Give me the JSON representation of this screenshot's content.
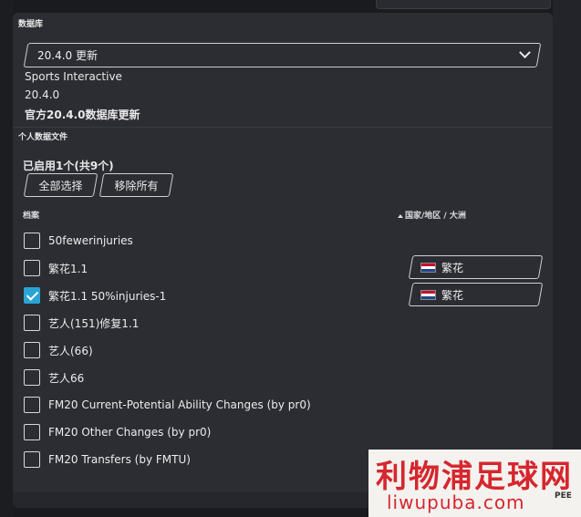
{
  "database": {
    "section_title": "数据库",
    "selected_version": "20.4.0 更新",
    "publisher": "Sports Interactive",
    "version": "20.4.0",
    "description": "官方20.4.0数据库更新"
  },
  "personal_files": {
    "section_title": "个人数据文件",
    "enabled_summary": "已启用1个(共9个)",
    "select_all_label": "全部选择",
    "remove_all_label": "移除所有",
    "col_file": "档案",
    "col_region": "国家/地区 / 大洲",
    "items": [
      {
        "label": "50fewerinjuries",
        "checked": false
      },
      {
        "label": "繁花1.1",
        "checked": false,
        "nation": "繁花"
      },
      {
        "label": "繁花1.1 50%injuries-1",
        "checked": true,
        "nation": "繁花"
      },
      {
        "label": "艺人(151)修复1.1",
        "checked": false
      },
      {
        "label": "艺人(66)",
        "checked": false
      },
      {
        "label": "艺人66",
        "checked": false
      },
      {
        "label": "FM20 Current-Potential Ability Changes (by pr0)",
        "checked": false
      },
      {
        "label": "FM20 Other Changes (by pr0)",
        "checked": false
      },
      {
        "label": "FM20 Transfers (by FMTU)",
        "checked": false
      }
    ]
  },
  "colors": {
    "panel": "#2c2d32",
    "accent_check": "#2aa4d6",
    "flag_red": "#c8102e",
    "flag_white": "#ffffff",
    "flag_blue": "#21468b"
  },
  "watermark": {
    "cn": "利物浦足球网",
    "en": "liwupuba.com",
    "side": "PEE"
  }
}
